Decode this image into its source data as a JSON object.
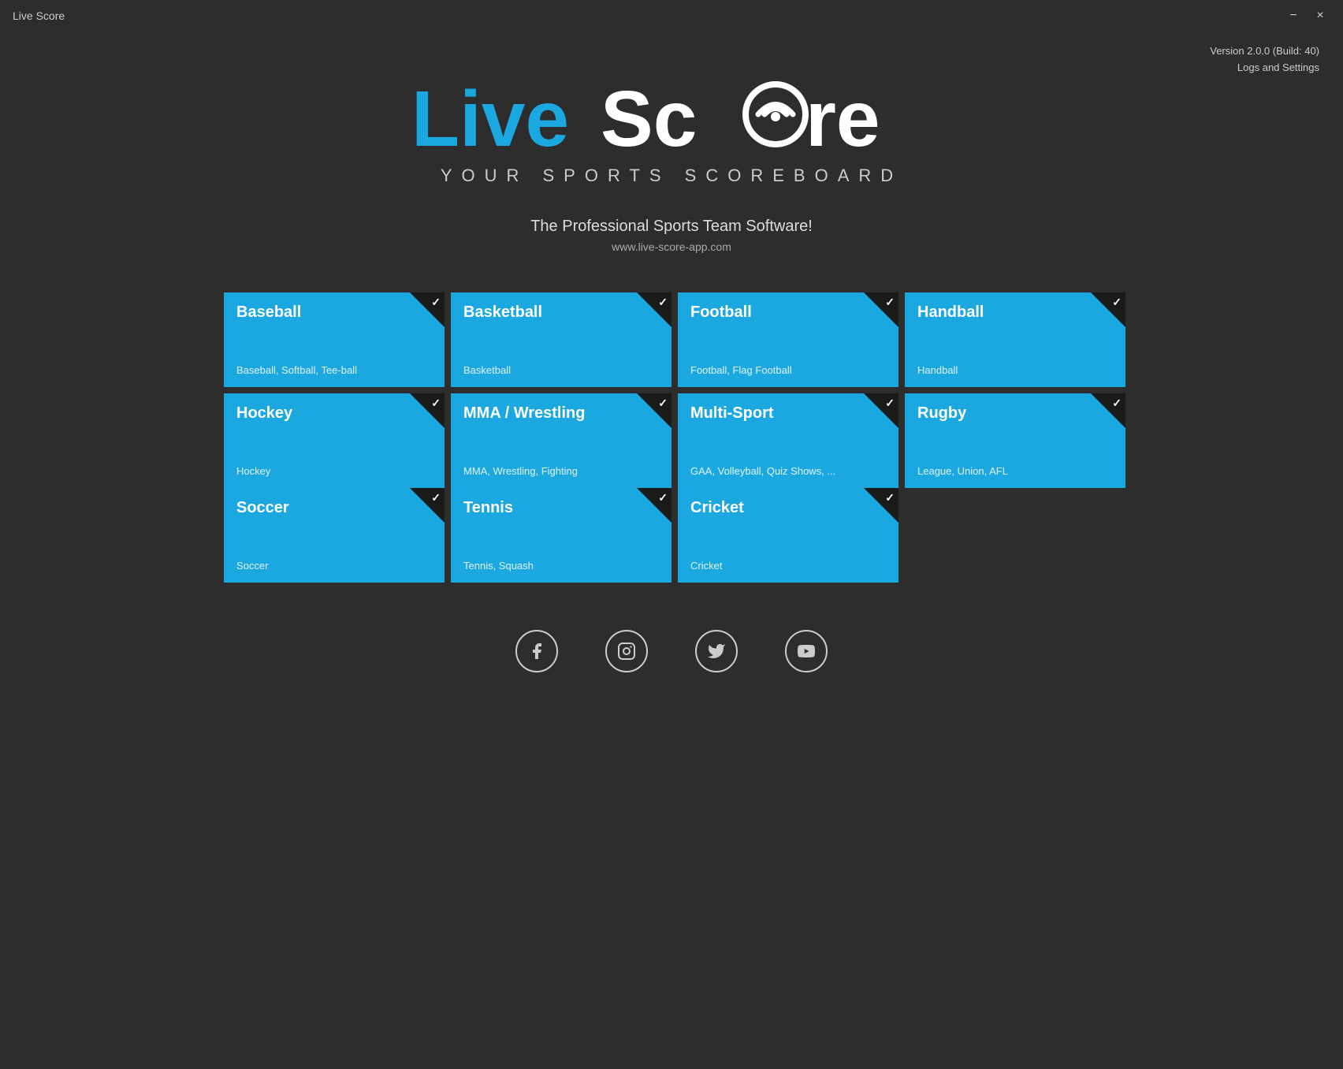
{
  "titleBar": {
    "title": "Live Score",
    "minimizeLabel": "−",
    "closeLabel": "×"
  },
  "version": {
    "text": "Version 2.0.0 (Build: 40)",
    "logsLabel": "Logs and Settings"
  },
  "logo": {
    "live": "Live",
    "score": "Score",
    "subtitle": "YOUR SPORTS SCOREBOARD",
    "tagline": "The Professional Sports Team Software!",
    "website": "www.live-score-app.com"
  },
  "sports": [
    {
      "title": "Baseball",
      "subtitle": "Baseball, Softball, Tee-ball",
      "checked": true,
      "row": 1
    },
    {
      "title": "Basketball",
      "subtitle": "Basketball",
      "checked": true,
      "row": 1
    },
    {
      "title": "Football",
      "subtitle": "Football, Flag Football",
      "checked": true,
      "row": 1
    },
    {
      "title": "Handball",
      "subtitle": "Handball",
      "checked": true,
      "row": 1
    },
    {
      "title": "Hockey",
      "subtitle": "Hockey",
      "checked": true,
      "row": 2
    },
    {
      "title": "MMA / Wrestling",
      "subtitle": "MMA, Wrestling, Fighting",
      "checked": true,
      "row": 2
    },
    {
      "title": "Multi-Sport",
      "subtitle": "GAA, Volleyball, Quiz Shows, ...",
      "checked": true,
      "row": 2
    },
    {
      "title": "Rugby",
      "subtitle": "League, Union, AFL",
      "checked": true,
      "row": 2
    },
    {
      "title": "Soccer",
      "subtitle": "Soccer",
      "checked": true,
      "row": 3
    },
    {
      "title": "Tennis",
      "subtitle": "Tennis, Squash",
      "checked": true,
      "row": 3
    },
    {
      "title": "Cricket",
      "subtitle": "Cricket",
      "checked": true,
      "row": 3
    }
  ],
  "social": [
    {
      "name": "facebook",
      "icon": "f"
    },
    {
      "name": "instagram",
      "icon": "◎"
    },
    {
      "name": "twitter",
      "icon": "𝕏"
    },
    {
      "name": "youtube",
      "icon": "▶"
    }
  ]
}
